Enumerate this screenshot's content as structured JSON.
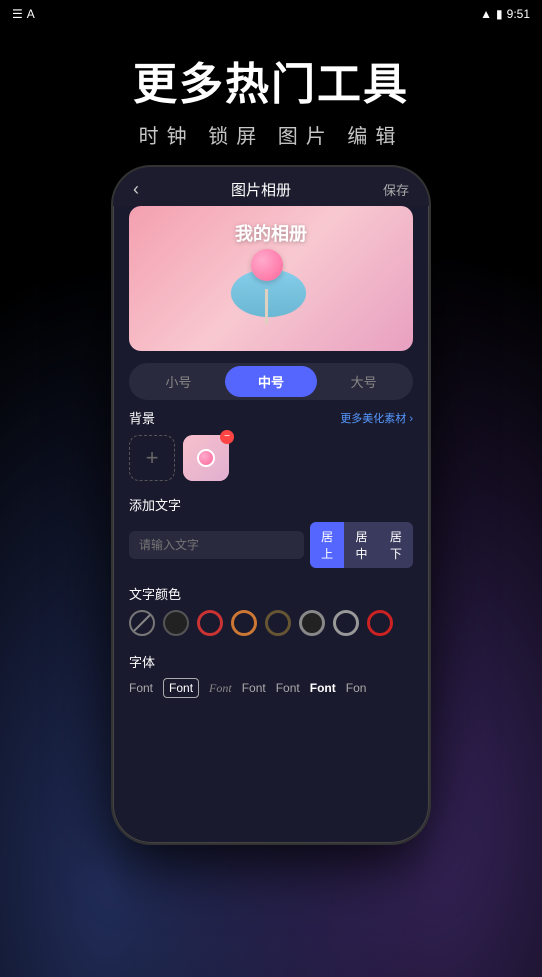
{
  "statusBar": {
    "leftIcon": "☰",
    "appIcon": "A",
    "wifi": "wifi",
    "battery": "battery",
    "time": "9:51"
  },
  "hero": {
    "title": "更多热门工具",
    "subtitle": "时钟 锁屏 图片 编辑"
  },
  "phone": {
    "backLabel": "‹",
    "titleLabel": "图片相册",
    "saveLabel": "保存",
    "albumTitle": "我的相册",
    "sizeOptions": [
      "小号",
      "中号",
      "大号"
    ],
    "activeSizeIndex": 1,
    "backgroundSection": "背景",
    "backgroundMore": "更多美化素材 ›",
    "addTextSection": "添加文字",
    "textPlaceholder": "请输入文字",
    "alignButtons": [
      "居上",
      "居中",
      "居下"
    ],
    "activeAlignIndex": 0,
    "colorSection": "文字颜色",
    "colors": [
      {
        "id": "none",
        "bg": "transparent",
        "label": "none"
      },
      {
        "id": "black",
        "bg": "#222222",
        "label": "black"
      },
      {
        "id": "red-ring",
        "bg": "transparent",
        "border": "#cc3333",
        "label": "red ring"
      },
      {
        "id": "orange-ring",
        "bg": "transparent",
        "border": "#cc7733",
        "label": "orange ring"
      },
      {
        "id": "dark-ring",
        "bg": "transparent",
        "border": "#443322",
        "label": "dark ring"
      },
      {
        "id": "dark2",
        "bg": "#222",
        "border": "#888",
        "label": "dark 2"
      },
      {
        "id": "grey-ring",
        "bg": "transparent",
        "border": "#888",
        "label": "grey ring"
      },
      {
        "id": "red2",
        "bg": "transparent",
        "border": "#cc2222",
        "label": "red 2"
      }
    ],
    "fontSection": "字体",
    "fonts": [
      {
        "label": "Font",
        "style": "normal",
        "selected": false
      },
      {
        "label": "Font",
        "style": "normal",
        "selected": true
      },
      {
        "label": "Font",
        "style": "thin",
        "selected": false
      },
      {
        "label": "Font",
        "style": "normal",
        "selected": false
      },
      {
        "label": "Font",
        "style": "normal",
        "selected": false
      },
      {
        "label": "Font",
        "style": "bold",
        "selected": false
      },
      {
        "label": "Fon",
        "style": "normal",
        "selected": false,
        "clipped": true
      }
    ]
  }
}
